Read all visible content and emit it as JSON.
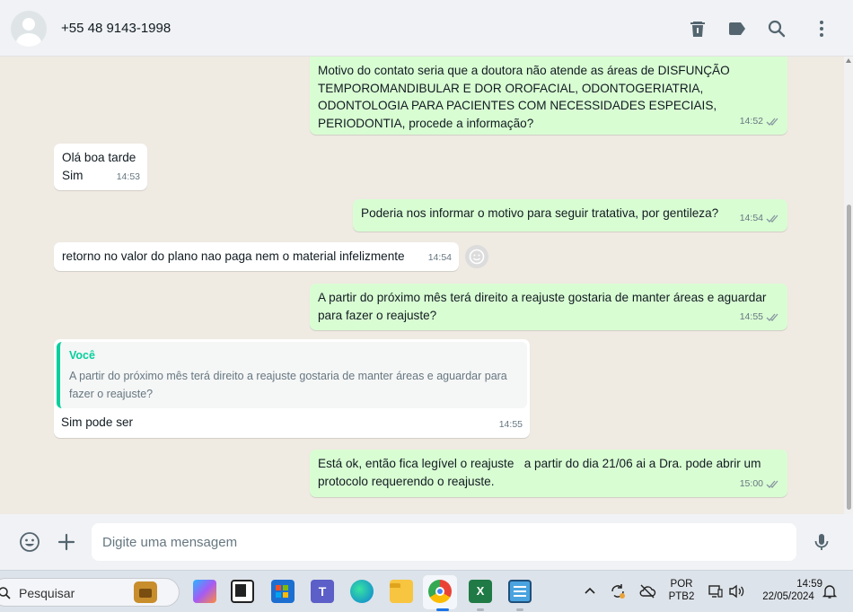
{
  "header": {
    "contact_name": "+55 48 9143-1998",
    "icons": [
      "delete-icon",
      "label-icon",
      "search-icon",
      "menu-icon"
    ]
  },
  "messages": [
    {
      "direction": "out",
      "text": "Motivo do contato seria que a doutora não atende as áreas de DISFUNÇÃO TEMPOROMANDIBULAR E DOR OROFACIAL, ODONTOGERIATRIA, ODONTOLOGIA PARA PACIENTES COM NECESSIDADES ESPECIAIS, PERIODONTIA, procede a informação?",
      "time": "14:52",
      "status": "read"
    },
    {
      "direction": "in",
      "text": "Olá boa tarde\nSim",
      "time": "14:53"
    },
    {
      "direction": "out",
      "text": "Poderia nos informar o motivo para seguir tratativa, por gentileza?",
      "time": "14:54",
      "status": "read"
    },
    {
      "direction": "in",
      "text": "retorno no valor do plano nao paga nem o material infelizmente",
      "time": "14:54"
    },
    {
      "direction": "out",
      "text": "A partir do próximo mês terá direito a reajuste gostaria de manter áreas e aguardar para fazer o reajuste?",
      "time": "14:55",
      "status": "read"
    },
    {
      "direction": "in",
      "quote_author": "Você",
      "quote_text": "A partir do próximo mês terá direito a reajuste gostaria de manter áreas e aguardar para fazer o reajuste?",
      "text": "Sim pode ser",
      "time": "14:55"
    },
    {
      "direction": "out",
      "text": "Está ok, então fica legível o reajuste   a partir do dia 21/06 ai a Dra. pode abrir um protocolo requerendo o reajuste.",
      "time": "15:00",
      "status": "read"
    }
  ],
  "compose": {
    "placeholder": "Digite uma mensagem"
  },
  "taskbar": {
    "search_label": "Pesquisar",
    "apps": [
      "work-app-icon",
      "copilot-icon",
      "task-view-icon",
      "store-icon",
      "teams-icon",
      "edge-icon",
      "file-explorer-icon",
      "chrome-icon",
      "excel-icon",
      "notepad-icon"
    ],
    "lang_top": "POR",
    "lang_bottom": "PTB2",
    "time": "14:59",
    "date": "22/05/2024"
  },
  "colors": {
    "outgoing_bubble": "#d9fdd3",
    "incoming_bubble": "#ffffff",
    "chat_bg": "#efeae2",
    "quote_accent": "#06cf9c",
    "read_ticks": "#8696a0"
  }
}
